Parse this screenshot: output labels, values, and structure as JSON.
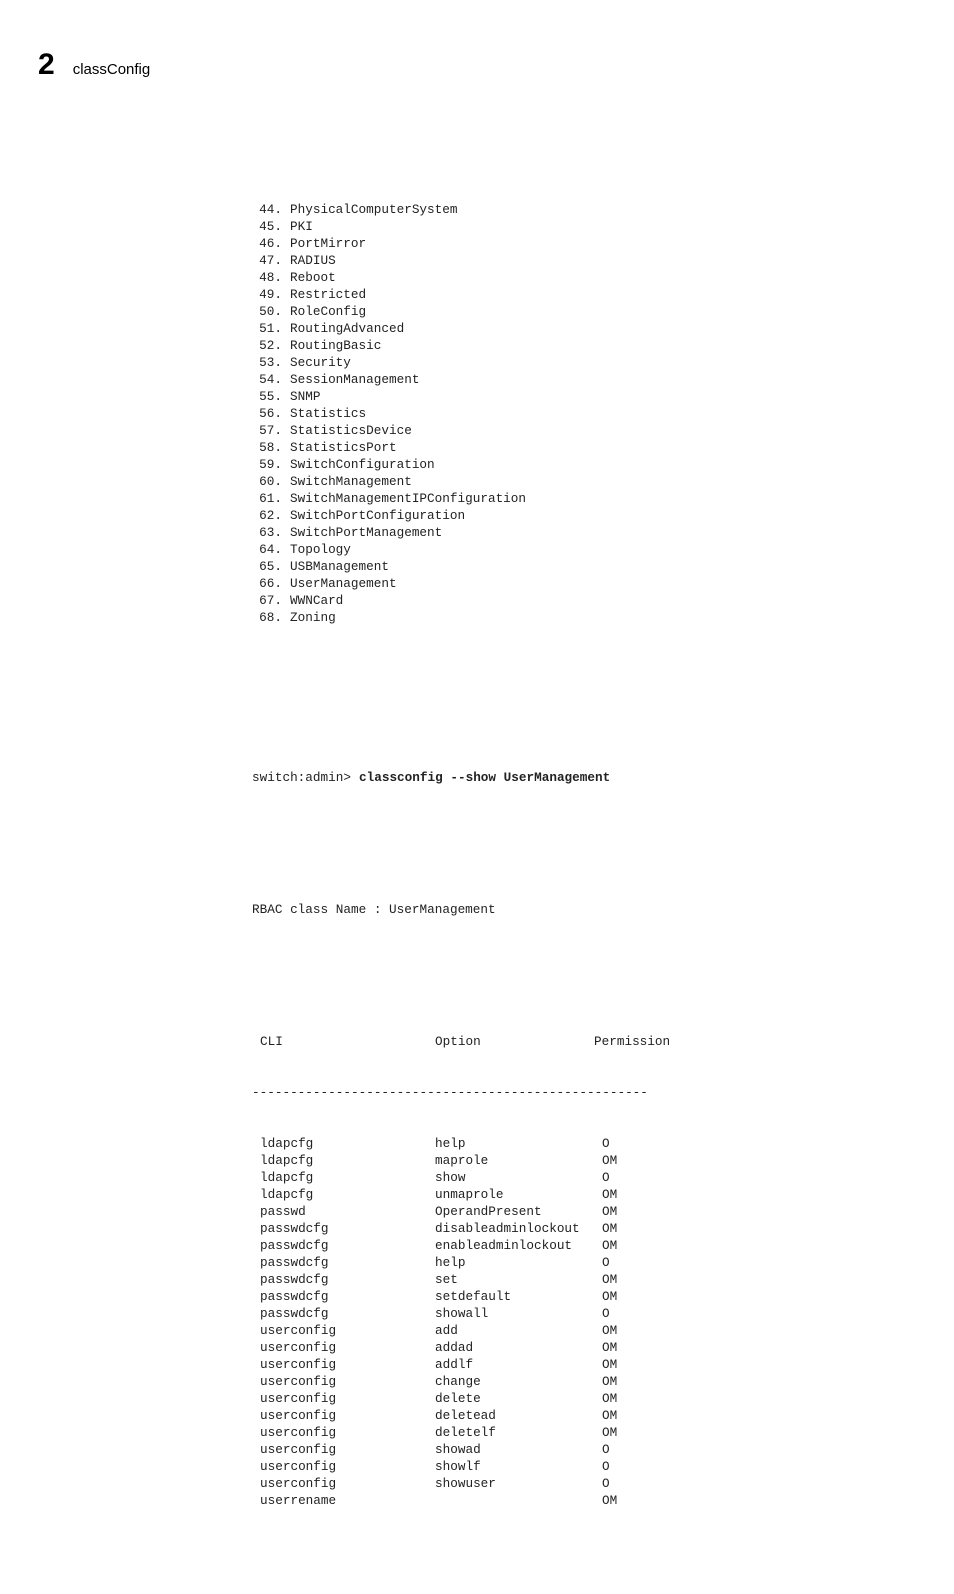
{
  "header": {
    "chapter_number": "2",
    "section_name": "classConfig"
  },
  "rbac_list": [
    {
      "n": "44",
      "name": "PhysicalComputerSystem"
    },
    {
      "n": "45",
      "name": "PKI"
    },
    {
      "n": "46",
      "name": "PortMirror"
    },
    {
      "n": "47",
      "name": "RADIUS"
    },
    {
      "n": "48",
      "name": "Reboot"
    },
    {
      "n": "49",
      "name": "Restricted"
    },
    {
      "n": "50",
      "name": "RoleConfig"
    },
    {
      "n": "51",
      "name": "RoutingAdvanced"
    },
    {
      "n": "52",
      "name": "RoutingBasic"
    },
    {
      "n": "53",
      "name": "Security"
    },
    {
      "n": "54",
      "name": "SessionManagement"
    },
    {
      "n": "55",
      "name": "SNMP"
    },
    {
      "n": "56",
      "name": "Statistics"
    },
    {
      "n": "57",
      "name": "StatisticsDevice"
    },
    {
      "n": "58",
      "name": "StatisticsPort"
    },
    {
      "n": "59",
      "name": "SwitchConfiguration"
    },
    {
      "n": "60",
      "name": "SwitchManagement"
    },
    {
      "n": "61",
      "name": "SwitchManagementIPConfiguration"
    },
    {
      "n": "62",
      "name": "SwitchPortConfiguration"
    },
    {
      "n": "63",
      "name": "SwitchPortManagement"
    },
    {
      "n": "64",
      "name": "Topology"
    },
    {
      "n": "65",
      "name": "USBManagement"
    },
    {
      "n": "66",
      "name": "UserManagement"
    },
    {
      "n": "67",
      "name": "WWNCard"
    },
    {
      "n": "68",
      "name": "Zoning"
    }
  ],
  "command": {
    "prompt": "switch:admin>",
    "text": "classconfig --show UserManagement"
  },
  "rbac_title": "RBAC class Name : UserManagement",
  "table": {
    "headers": {
      "cli": "CLI",
      "option": "Option",
      "permission": "Permission"
    },
    "rule": "----------------------------------------------------",
    "rows": [
      {
        "cli": "ldapcfg",
        "option": "help",
        "perm": "O"
      },
      {
        "cli": "ldapcfg",
        "option": "maprole",
        "perm": "OM"
      },
      {
        "cli": "ldapcfg",
        "option": "show",
        "perm": "O"
      },
      {
        "cli": "ldapcfg",
        "option": "unmaprole",
        "perm": "OM"
      },
      {
        "cli": "passwd",
        "option": "OperandPresent",
        "perm": "OM"
      },
      {
        "cli": "passwdcfg",
        "option": "disableadminlockout",
        "perm": "OM"
      },
      {
        "cli": "passwdcfg",
        "option": "enableadminlockout",
        "perm": "OM"
      },
      {
        "cli": "passwdcfg",
        "option": "help",
        "perm": "O"
      },
      {
        "cli": "passwdcfg",
        "option": "set",
        "perm": "OM"
      },
      {
        "cli": "passwdcfg",
        "option": "setdefault",
        "perm": "OM"
      },
      {
        "cli": "passwdcfg",
        "option": "showall",
        "perm": "O"
      },
      {
        "cli": "userconfig",
        "option": "add",
        "perm": "OM"
      },
      {
        "cli": "userconfig",
        "option": "addad",
        "perm": "OM"
      },
      {
        "cli": "userconfig",
        "option": "addlf",
        "perm": "OM"
      },
      {
        "cli": "userconfig",
        "option": "change",
        "perm": "OM"
      },
      {
        "cli": "userconfig",
        "option": "delete",
        "perm": "OM"
      },
      {
        "cli": "userconfig",
        "option": "deletead",
        "perm": "OM"
      },
      {
        "cli": "userconfig",
        "option": "deletelf",
        "perm": "OM"
      },
      {
        "cli": "userconfig",
        "option": "showad",
        "perm": "O"
      },
      {
        "cli": "userconfig",
        "option": "showlf",
        "perm": "O"
      },
      {
        "cli": "userconfig",
        "option": "showuser",
        "perm": "O"
      },
      {
        "cli": "userrename",
        "option": "",
        "perm": "OM"
      }
    ]
  }
}
